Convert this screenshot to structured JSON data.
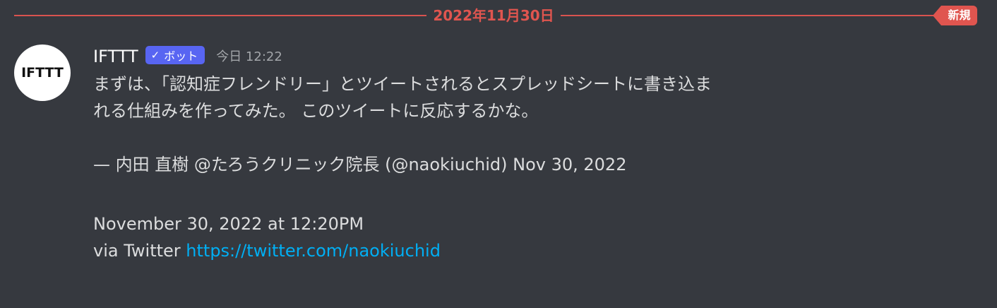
{
  "divider": {
    "date": "2022年11月30日",
    "new_label": "新規"
  },
  "colors": {
    "background": "#36393f",
    "divider_red": "#e0554f",
    "bot_tag": "#5865f2",
    "link": "#00aff4",
    "text": "#dcddde",
    "muted": "#a3a6aa"
  },
  "message": {
    "avatar_text": "IFTTT",
    "username": "IFTTT",
    "bot_icon": "check-icon",
    "bot_label": "ボット",
    "timestamp": "今日 12:22",
    "lines": {
      "l1": "まずは、「認知症フレンドリー」とツイートされるとスプレッドシートに書き込ま",
      "l2": "れる仕組みを作ってみた。 このツイートに反応するかな。",
      "l3": "— 内田 直樹 @たろうクリニック院長 (@naokiuchid) Nov 30, 2022",
      "l4": "November 30, 2022 at 12:20PM",
      "l5_prefix": "via Twitter ",
      "l5_link": "https://twitter.com/naokiuchid"
    }
  }
}
